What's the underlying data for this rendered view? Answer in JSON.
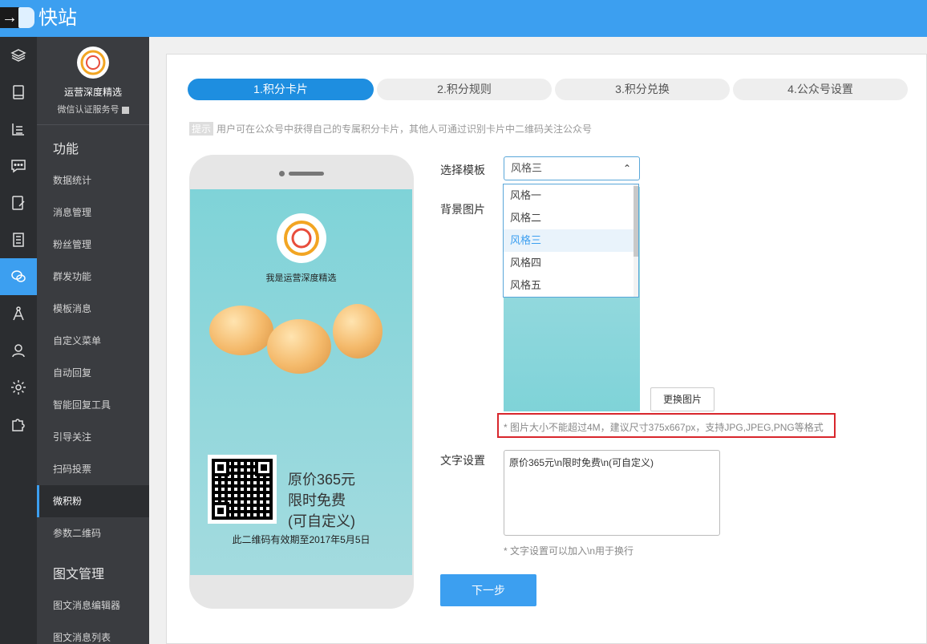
{
  "app": {
    "title": "快站",
    "brand_color": "#3c9ff0"
  },
  "account": {
    "name": "运营深度精选",
    "type": "微信认证服务号"
  },
  "sidebar": {
    "section1": "功能",
    "items": [
      "数据统计",
      "消息管理",
      "粉丝管理",
      "群发功能",
      "模板消息",
      "自定义菜单",
      "自动回复",
      "智能回复工具",
      "引导关注",
      "扫码投票",
      "微积粉",
      "参数二维码"
    ],
    "active_item": "微积粉",
    "section2": "图文管理",
    "items2": [
      "图文消息编辑器",
      "图文消息列表"
    ]
  },
  "rail_icons": [
    "layers-icon",
    "tablet-icon",
    "list-tree-icon",
    "chat-icon",
    "note-edit-icon",
    "document-icon",
    "wechat-icon",
    "compass-icon",
    "user-icon",
    "gear-icon",
    "puzzle-icon"
  ],
  "steps": [
    "1.积分卡片",
    "2.积分规则",
    "3.积分兑换",
    "4.公众号设置"
  ],
  "tip": {
    "badge": "提示",
    "text": "用户可在公众号中获得自己的专属积分卡片，其他人可通过识别卡片中二维码关注公众号"
  },
  "card": {
    "account_line": "我是运营深度精选",
    "line1": "原价365元",
    "line2": "限时免费",
    "line3": "(可自定义)",
    "expiry": "此二维码有效期至2017年5月5日"
  },
  "form": {
    "template_label": "选择模板",
    "template_value": "风格三",
    "template_options": [
      "风格一",
      "风格二",
      "风格三",
      "风格四",
      "风格五"
    ],
    "bg_label": "背景图片",
    "change_image_button": "更换图片",
    "image_note": "* 图片大小不能超过4M，建议尺寸375x667px，支持JPG,JPEG,PNG等格式",
    "text_label": "文字设置",
    "text_value": "原价365元\\n限时免费\\n(可自定义)",
    "text_note": "* 文字设置可以加入\\n用于换行",
    "next_button": "下一步"
  }
}
